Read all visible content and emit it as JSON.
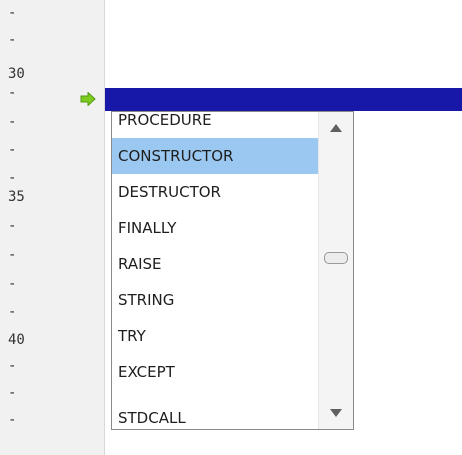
{
  "gutter": {
    "markers": [
      "-",
      "-",
      "30",
      "-",
      "-",
      "-",
      "-",
      "35",
      "-",
      "-",
      "-",
      "-",
      "40",
      "-",
      "-",
      "-"
    ]
  },
  "execution": {
    "arrow_icon": "green-right-arrow-icon",
    "highlight_color": "#1818a8"
  },
  "completion": {
    "items": [
      "PROCEDURE",
      "CONSTRUCTOR",
      "DESTRUCTOR",
      "FINALLY",
      "RAISE",
      "STRING",
      "TRY",
      "EXCEPT",
      "STDCALL"
    ],
    "selected": "CONSTRUCTOR",
    "selected_color": "#9ac8f0"
  }
}
